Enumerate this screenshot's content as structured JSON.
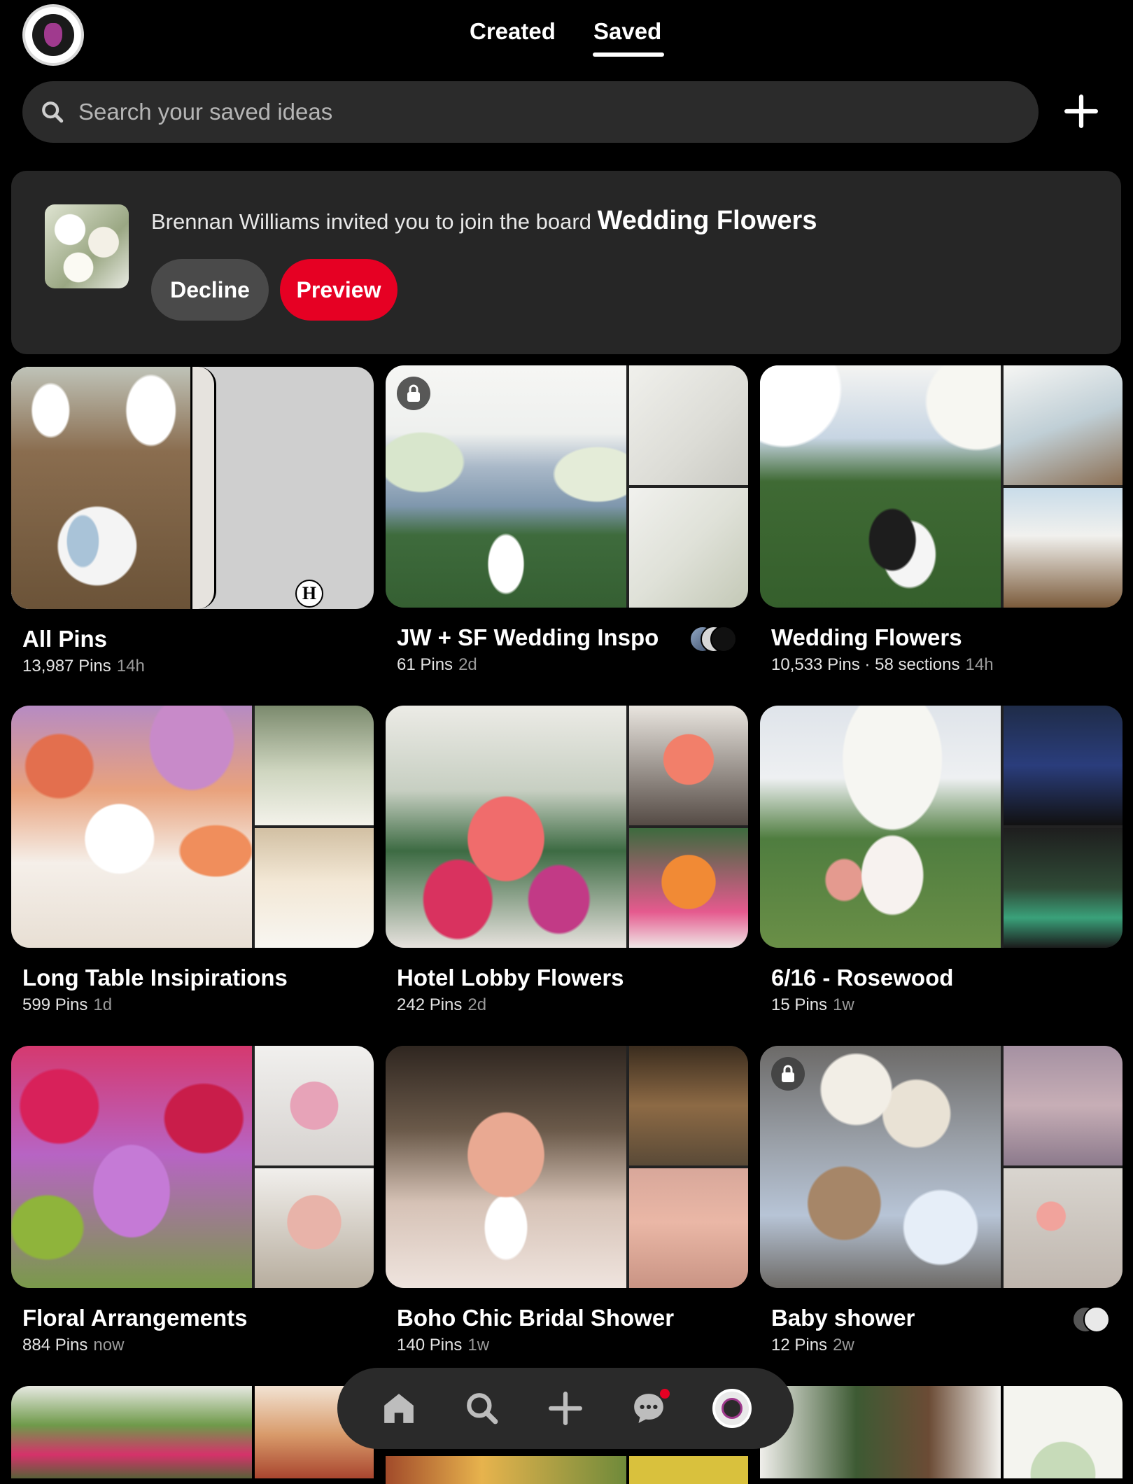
{
  "header": {
    "tabs": [
      {
        "label": "Created",
        "active": false
      },
      {
        "label": "Saved",
        "active": true
      }
    ]
  },
  "search": {
    "placeholder": "Search your saved ideas",
    "value": ""
  },
  "invite": {
    "message": "Brennan Williams invited you to join the board",
    "board_name": "Wedding Flowers",
    "decline_label": "Decline",
    "preview_label": "Preview"
  },
  "boards": [
    {
      "title": "All Pins",
      "pins": "13,987 Pins",
      "ago": "14h"
    },
    {
      "title": "JW + SF Wedding Inspo",
      "pins": "61 Pins",
      "ago": "2d",
      "private": true
    },
    {
      "title": "Wedding Flowers",
      "pins": "10,533 Pins · 58 sections",
      "ago": "14h"
    },
    {
      "title": "Long Table Insipirations",
      "pins": "599 Pins",
      "ago": "1d"
    },
    {
      "title": "Hotel Lobby Flowers",
      "pins": "242 Pins",
      "ago": "2d"
    },
    {
      "title": "6/16 - Rosewood",
      "pins": "15 Pins",
      "ago": "1w"
    },
    {
      "title": "Floral Arrangements",
      "pins": "884 Pins",
      "ago": "now"
    },
    {
      "title": "Boho Chic Bridal Shower",
      "pins": "140 Pins",
      "ago": "1w"
    },
    {
      "title": "Baby shower",
      "pins": "12 Pins",
      "ago": "2w",
      "private": true
    }
  ],
  "bottom_nav": [
    "home-icon",
    "search-icon",
    "create-icon",
    "messages-icon",
    "profile-avatar"
  ],
  "colors": {
    "background": "#000000",
    "surface": "#262626",
    "search_bg": "#2b2b2b",
    "accent_red": "#e60023",
    "decline_bg": "#4a4a4a"
  }
}
